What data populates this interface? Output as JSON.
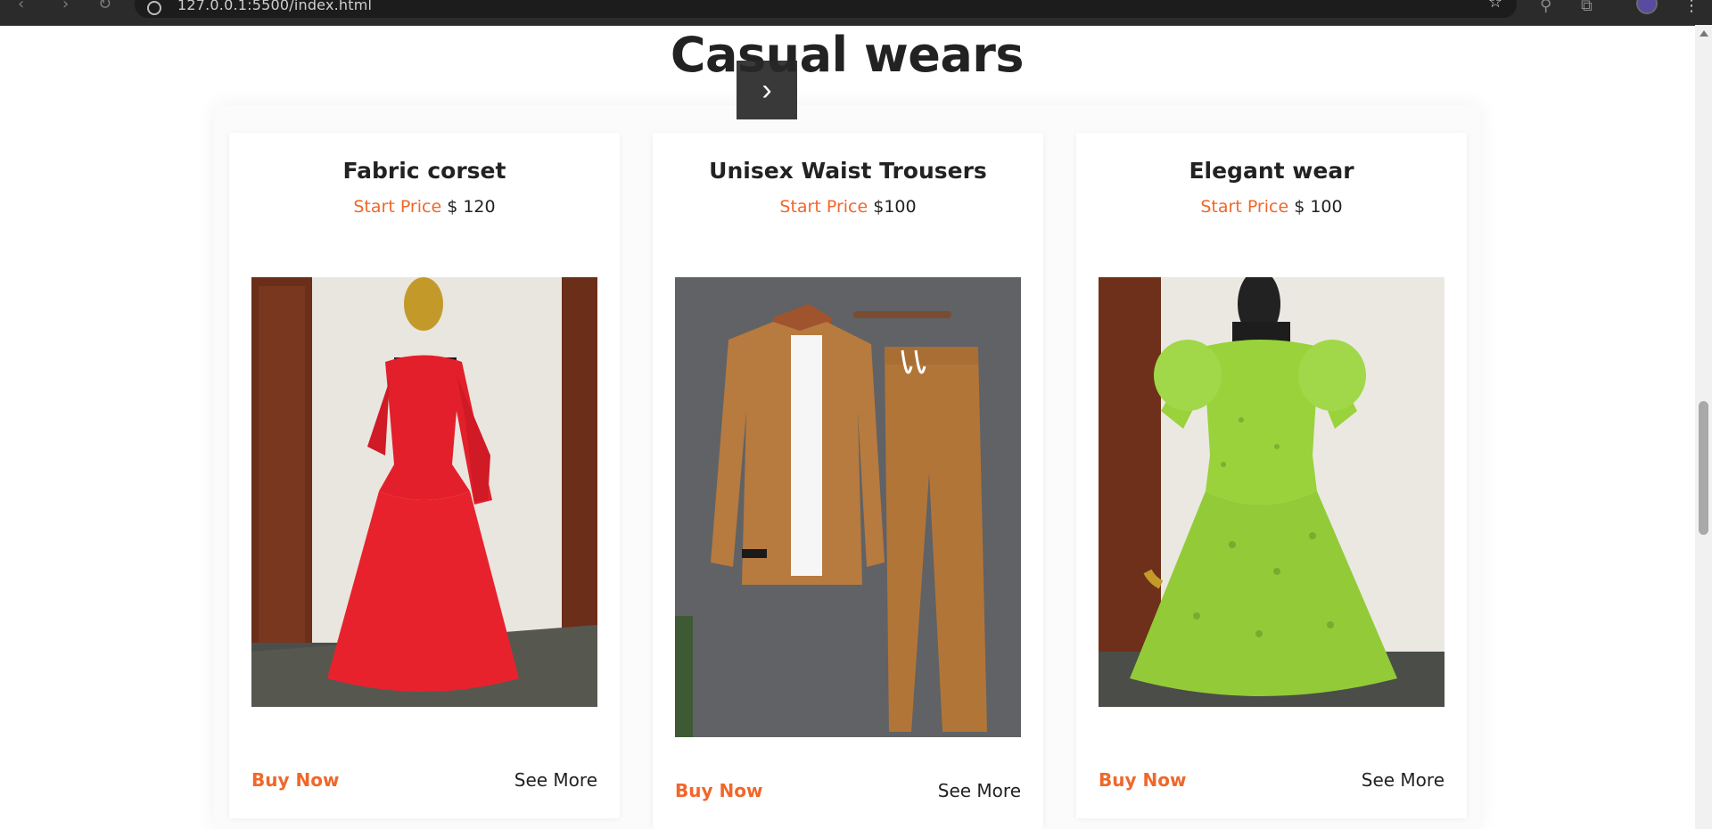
{
  "browser": {
    "url": "127.0.0.1:5500/index.html"
  },
  "section": {
    "title": "Casual wears",
    "next_icon": "chevron-right-icon"
  },
  "products": [
    {
      "name": "Fabric corset",
      "price_label": "Start Price",
      "price_value": "$ 120",
      "buy_label": "Buy Now",
      "more_label": "See More"
    },
    {
      "name": "Unisex Waist Trousers",
      "price_label": "Start Price",
      "price_value": "$100",
      "buy_label": "Buy Now",
      "more_label": "See More"
    },
    {
      "name": "Elegant wear",
      "price_label": "Start Price",
      "price_value": "$ 100",
      "buy_label": "Buy Now",
      "more_label": "See More"
    }
  ],
  "colors": {
    "accent": "#f0672a",
    "heading": "#222222"
  }
}
